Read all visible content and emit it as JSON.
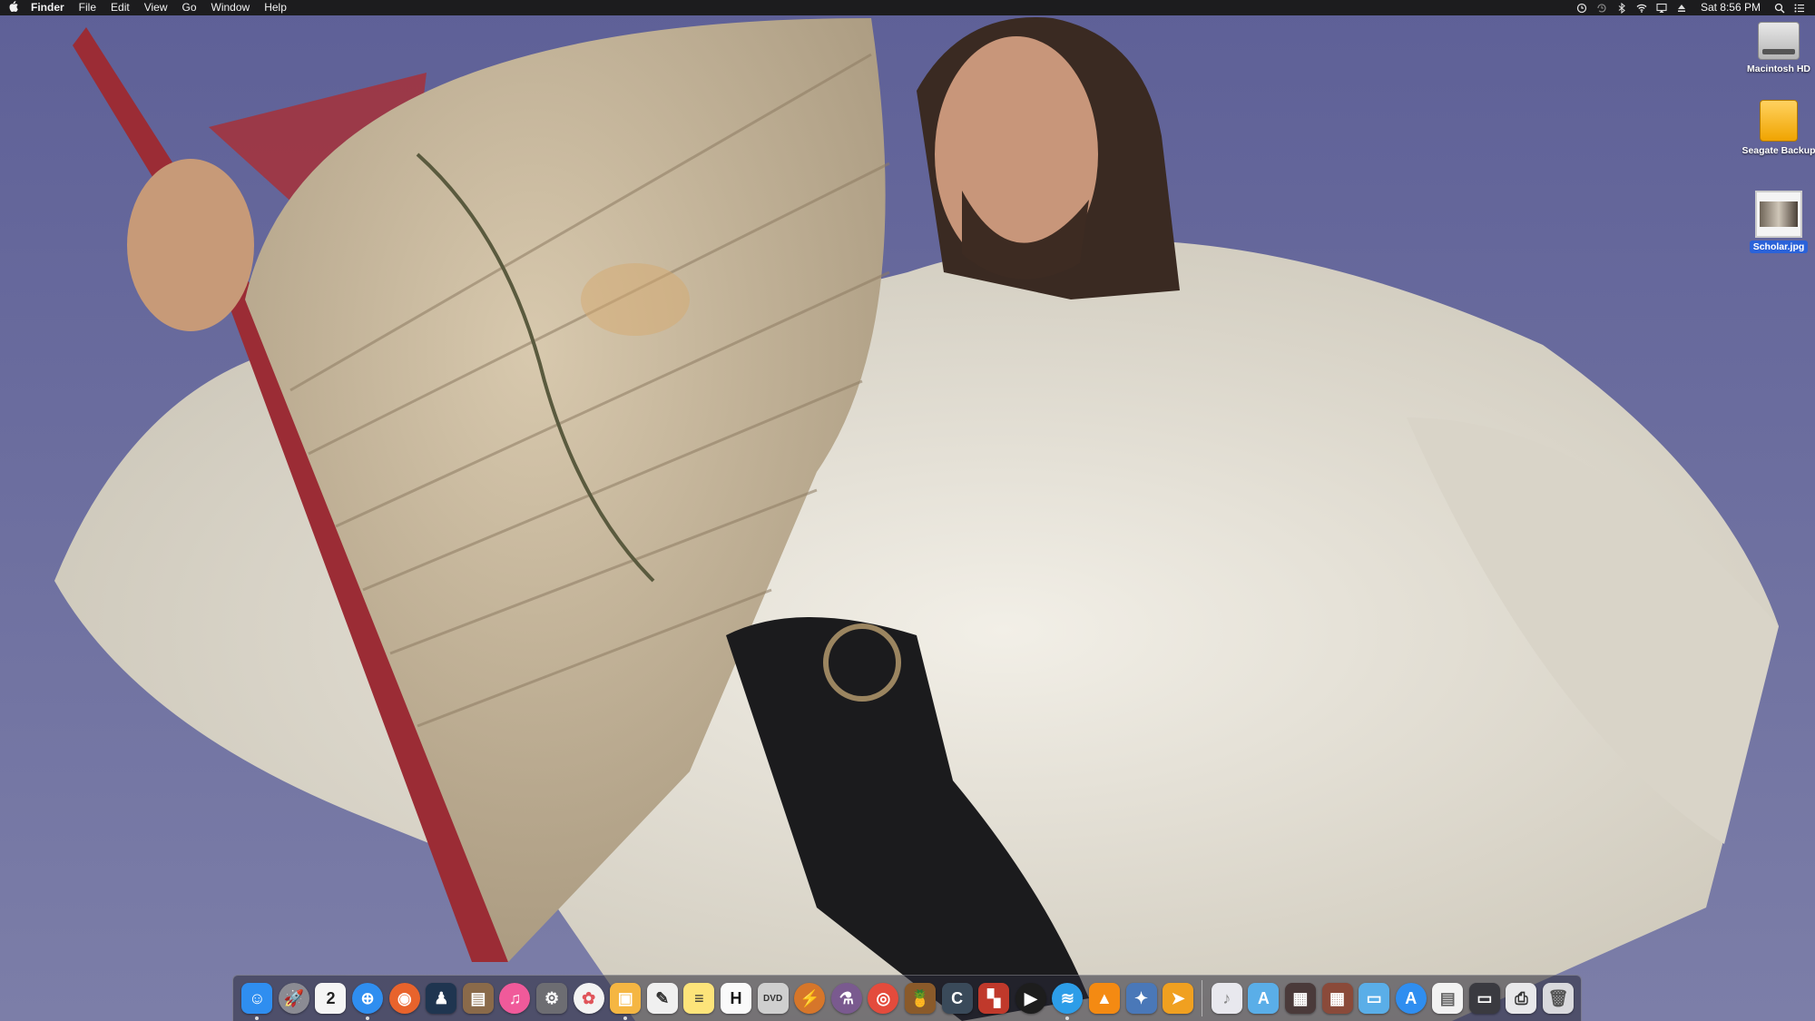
{
  "menubar": {
    "apple_icon": "apple-icon",
    "app_name": "Finder",
    "menus": [
      "File",
      "Edit",
      "View",
      "Go",
      "Window",
      "Help"
    ],
    "status_icons": [
      "screen-time-icon",
      "time-machine-icon",
      "bluetooth-icon",
      "wifi-icon",
      "airplay-icon",
      "eject-icon"
    ],
    "clock": "Sat 8:56 PM",
    "search_icon": "spotlight-icon",
    "notification_icon": "notification-center-icon"
  },
  "desktop": {
    "icons": [
      {
        "label": "Macintosh HD",
        "icon": "hard-drive-icon",
        "selected": false
      },
      {
        "label": "Seagate Backup",
        "icon": "external-drive-icon",
        "selected": false
      },
      {
        "label": "Scholar.jpg",
        "icon": "jpg-file-icon",
        "selected": true
      }
    ]
  },
  "dock": {
    "apps": [
      {
        "name": "finder",
        "glyph": "☺",
        "color": "#2f8ef0",
        "running": true
      },
      {
        "name": "launchpad",
        "glyph": "🚀",
        "color": "#8b8b93",
        "running": false,
        "round": true
      },
      {
        "name": "calendar",
        "glyph": "2",
        "color": "#f5f5f5",
        "text": "#222",
        "running": false
      },
      {
        "name": "safari",
        "glyph": "⊕",
        "color": "#2f8ef0",
        "running": true,
        "round": true
      },
      {
        "name": "firefox",
        "glyph": "◉",
        "color": "#e8632c",
        "running": false,
        "round": true
      },
      {
        "name": "kindle",
        "glyph": "♟",
        "color": "#1f3550",
        "running": false
      },
      {
        "name": "books",
        "glyph": "▤",
        "color": "#8a6a4a",
        "running": false
      },
      {
        "name": "itunes",
        "glyph": "♫",
        "color": "#f05a9a",
        "running": false,
        "round": true
      },
      {
        "name": "system-preferences",
        "glyph": "⚙",
        "color": "#6d6d72",
        "running": false
      },
      {
        "name": "photos",
        "glyph": "✿",
        "color": "#f3f3f3",
        "text": "#e0555b",
        "running": false,
        "round": true
      },
      {
        "name": "preview",
        "glyph": "▣",
        "color": "#f5b642",
        "running": true
      },
      {
        "name": "textedit",
        "glyph": "✎",
        "color": "#f0f0f0",
        "text": "#333",
        "running": false
      },
      {
        "name": "notes",
        "glyph": "≡",
        "color": "#fde47a",
        "text": "#333",
        "running": false
      },
      {
        "name": "hemingway",
        "glyph": "H",
        "color": "#fafafa",
        "text": "#111",
        "running": false
      },
      {
        "name": "dvd-player",
        "glyph": "DVD",
        "color": "#cfcfcf",
        "text": "#333",
        "running": false
      },
      {
        "name": "reeder",
        "glyph": "⚡",
        "color": "#d6762a",
        "running": false,
        "round": true
      },
      {
        "name": "potion-app",
        "glyph": "⚗",
        "color": "#7a5a8f",
        "running": false,
        "round": true
      },
      {
        "name": "chrome",
        "glyph": "◎",
        "color": "#e44b3c",
        "running": false,
        "round": true
      },
      {
        "name": "pineapple-app",
        "glyph": "🍍",
        "color": "#8a5a2a",
        "running": false
      },
      {
        "name": "c-app",
        "glyph": "C",
        "color": "#3a4a5a",
        "running": false
      },
      {
        "name": "pattern-app",
        "glyph": "▚",
        "color": "#c0392b",
        "running": false
      },
      {
        "name": "infuse",
        "glyph": "▶",
        "color": "#1d1d1d",
        "running": false,
        "round": true
      },
      {
        "name": "wifi-explorer",
        "glyph": "≋",
        "color": "#2d9de8",
        "running": true,
        "round": true
      },
      {
        "name": "vlc",
        "glyph": "▲",
        "color": "#f48a12",
        "running": false
      },
      {
        "name": "xcode-instruments",
        "glyph": "✦",
        "color": "#4a78b8",
        "running": false
      },
      {
        "name": "transmit",
        "glyph": "➤",
        "color": "#f0a020",
        "running": false
      }
    ],
    "stacks": [
      {
        "name": "music-folder",
        "glyph": "♪",
        "color": "#e8e8ee",
        "text": "#888"
      },
      {
        "name": "applications-folder",
        "glyph": "A",
        "color": "#5aaee8"
      },
      {
        "name": "movie-stack",
        "glyph": "▦",
        "color": "#4a3a3a"
      },
      {
        "name": "photo-stack",
        "glyph": "▦",
        "color": "#8a4a3a"
      },
      {
        "name": "folder",
        "glyph": "▭",
        "color": "#5aaee8"
      },
      {
        "name": "app-store",
        "glyph": "A",
        "color": "#2f8ef0",
        "round": true
      },
      {
        "name": "document-stack",
        "glyph": "▤",
        "color": "#f2f2f2",
        "text": "#666"
      },
      {
        "name": "monitor-stack",
        "glyph": "▭",
        "color": "#3a3a40"
      },
      {
        "name": "printer",
        "glyph": "⎙",
        "color": "#e8e8ea",
        "text": "#333"
      },
      {
        "name": "trash",
        "glyph": "🗑",
        "color": "#d9d9dd",
        "text": "#555"
      }
    ]
  }
}
